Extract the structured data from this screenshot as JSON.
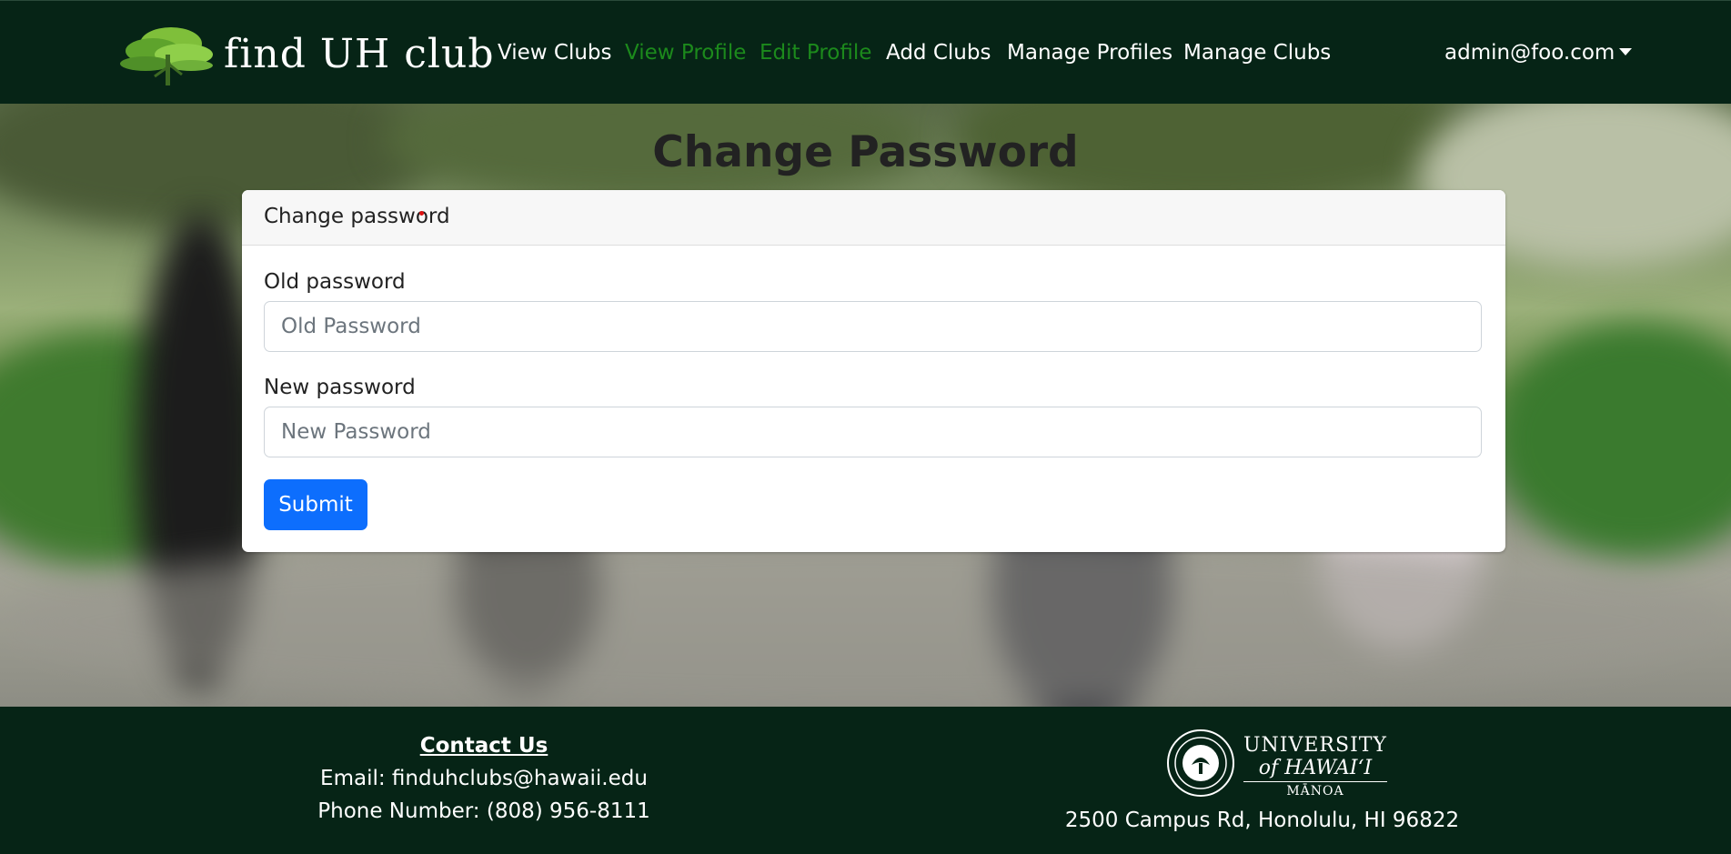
{
  "brand": {
    "name": "find UH club"
  },
  "nav": {
    "items": [
      {
        "label": "View Clubs"
      },
      {
        "label": "View Profile"
      },
      {
        "label": "Edit Profile"
      },
      {
        "label": "Add Clubs"
      },
      {
        "label": "Manage Profiles"
      },
      {
        "label": "Manage Clubs"
      }
    ],
    "user_email": "admin@foo.com"
  },
  "page": {
    "title": "Change Password",
    "card_header": "Change password",
    "old_password": {
      "label": "Old password",
      "placeholder": "Old Password",
      "value": ""
    },
    "new_password": {
      "label": "New password",
      "placeholder": "New Password",
      "value": ""
    },
    "submit_label": "Submit"
  },
  "footer": {
    "contact_title": "Contact Us",
    "email_line": "Email: finduhclubs@hawaii.edu",
    "phone_line": "Phone Number: (808) 956-8111",
    "university": {
      "line1": "UNIVERSITY",
      "line2": "of HAWAI‘I",
      "line3": "MĀNOA"
    },
    "address": "2500 Campus Rd, Honolulu, HI 96822"
  },
  "colors": {
    "navbar_bg": "#062416",
    "nav_active_green": "#1c8a1c",
    "submit_blue": "#0d6efd"
  }
}
